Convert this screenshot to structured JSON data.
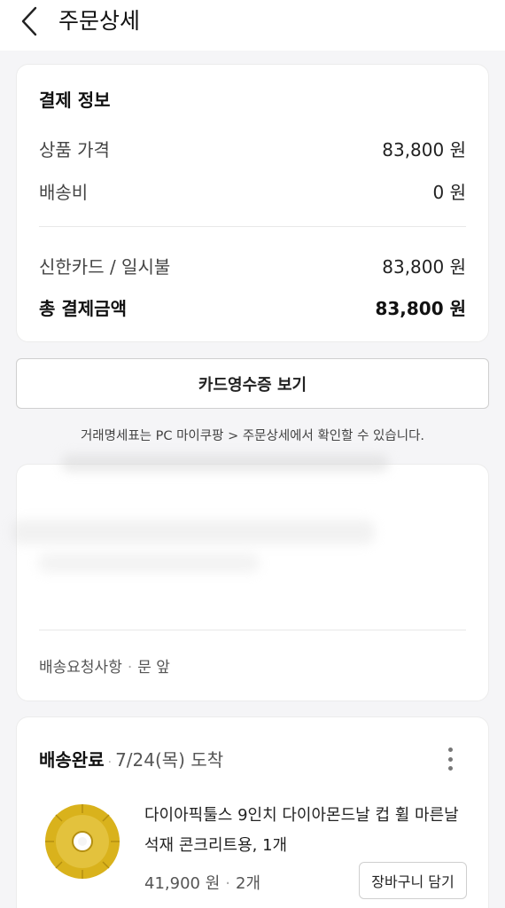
{
  "header": {
    "title": "주문상세"
  },
  "payment": {
    "title": "결제 정보",
    "product_price_label": "상품 가격",
    "product_price_value": "83,800 원",
    "shipping_label": "배송비",
    "shipping_value": "0 원",
    "card_label": "신한카드 / 일시불",
    "card_value": "83,800 원",
    "total_label": "총 결제금액",
    "total_value": "83,800 원"
  },
  "receipt_button": "카드영수증 보기",
  "notice": "거래명세표는 PC 마이쿠팡 > 주문상세에서 확인할 수 있습니다.",
  "address": {
    "request_label": "배송요청사항",
    "request_value": "문 앞"
  },
  "order": {
    "status": "배송완료",
    "arrival": "7/24(목) 도착",
    "product_name": "다이아픽툴스 9인치 다이아몬드날 컵 휠 마른날 석재 콘크리트용, 1개",
    "price": "41,900 원",
    "qty": "2개",
    "cart_button": "장바구니 담기"
  },
  "colors": {
    "background": "#f5f5f7",
    "card": "#ffffff",
    "product_gold": "#d9b21c"
  },
  "icons": {
    "back": "chevron-left-icon",
    "more": "more-vertical-icon"
  }
}
